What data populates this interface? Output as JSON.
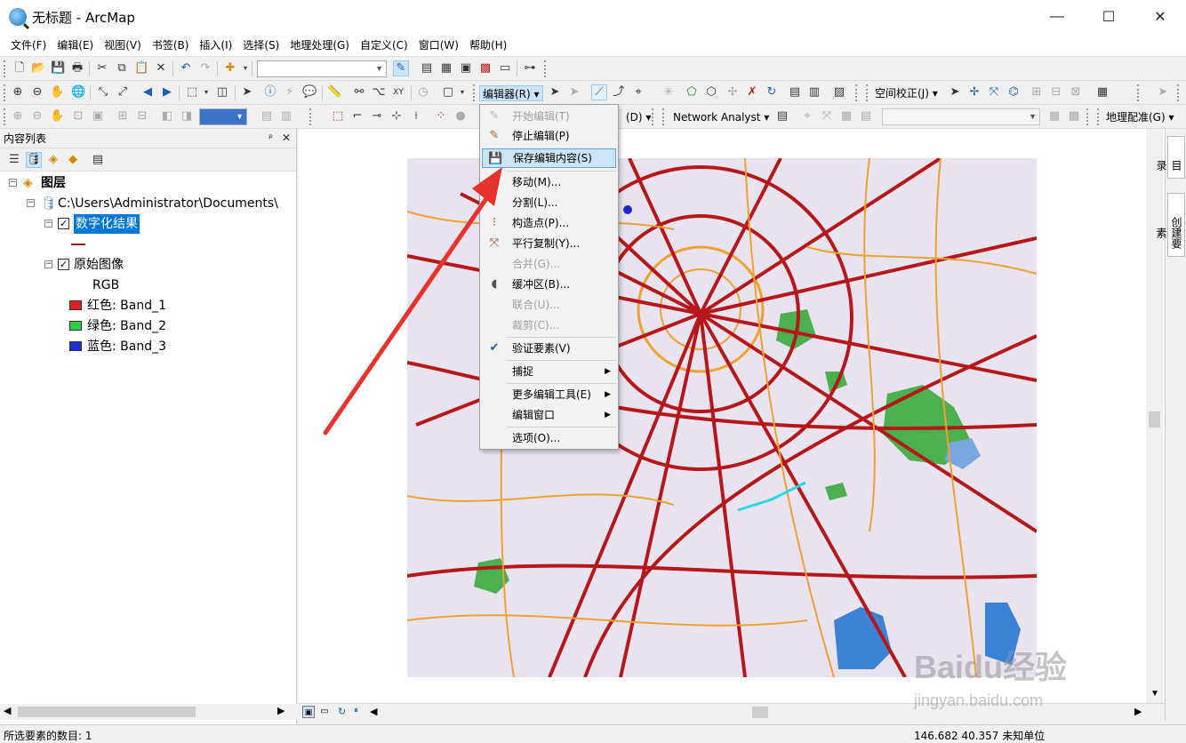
{
  "window": {
    "title": "无标题 - ArcMap",
    "minimize": "—",
    "maximize": "☐",
    "close": "✕"
  },
  "menu": [
    "文件(F)",
    "编辑(E)",
    "视图(V)",
    "书签(B)",
    "插入(I)",
    "选择(S)",
    "地理处理(G)",
    "自定义(C)",
    "窗口(W)",
    "帮助(H)"
  ],
  "toolbar": {
    "editor_label": "编辑器(R)",
    "spatial_adjust_label": "空间校正(J)",
    "network_analyst_label": "Network Analyst",
    "georef_label": "地理配准(G)",
    "partial_label": "(D)",
    "scale_value": ""
  },
  "toc": {
    "title": "内容列表",
    "pin": "ᵖ",
    "close": "✕",
    "root_label": "图层",
    "folder_label": "C:\\Users\\Administrator\\Documents\\",
    "layer1": {
      "label": "数字化结果",
      "checked": true,
      "line_color": "#9b1c1c"
    },
    "layer2": {
      "label": "原始图像",
      "checked": true
    },
    "rgb_label": "RGB",
    "bands": [
      {
        "label": "红色:   Band_1",
        "color": "#e02020"
      },
      {
        "label": "绿色: Band_2",
        "color": "#2ecc40"
      },
      {
        "label": "蓝色:   Band_3",
        "color": "#1e2fd6"
      }
    ]
  },
  "editor_menu": {
    "items": [
      {
        "label": "开始编辑(T)",
        "disabled": true,
        "icon": "pencil-icon"
      },
      {
        "label": "停止编辑(P)",
        "disabled": false,
        "icon": "stop-edit-icon"
      },
      {
        "label": "保存编辑内容(S)",
        "disabled": false,
        "icon": "save-edits-icon",
        "highlighted": true
      },
      {
        "label": "移动(M)...",
        "disabled": false
      },
      {
        "label": "分割(L)...",
        "disabled": false
      },
      {
        "label": "构造点(P)...",
        "disabled": false,
        "icon": "construct-points-icon"
      },
      {
        "label": "平行复制(Y)...",
        "disabled": false,
        "icon": "copy-parallel-icon"
      },
      {
        "label": "合并(G)...",
        "disabled": true
      },
      {
        "label": "缓冲区(B)...",
        "disabled": false,
        "icon": "buffer-icon"
      },
      {
        "label": "联合(U)...",
        "disabled": true
      },
      {
        "label": "裁剪(C)...",
        "disabled": true
      },
      {
        "label": "验证要素(V)",
        "disabled": false,
        "icon": "validate-icon"
      },
      {
        "label": "捕捉",
        "disabled": false,
        "submenu": true
      },
      {
        "label": "更多编辑工具(E)",
        "disabled": false,
        "submenu": true
      },
      {
        "label": "编辑窗口",
        "disabled": false,
        "submenu": true
      },
      {
        "label": "选项(O)...",
        "disabled": false
      }
    ]
  },
  "side_tabs": [
    "目录",
    "创建要素"
  ],
  "status": {
    "left": "所选要素的数目: 1",
    "coords": "146.682   40.357 未知单位"
  },
  "watermark": {
    "brand": "Baidu经验",
    "url": "jingyan.baidu.com"
  },
  "colors": {
    "annotation_arrow": "#e8322c",
    "menu_highlight": "#cce4f7",
    "selection": "#0078d7"
  }
}
